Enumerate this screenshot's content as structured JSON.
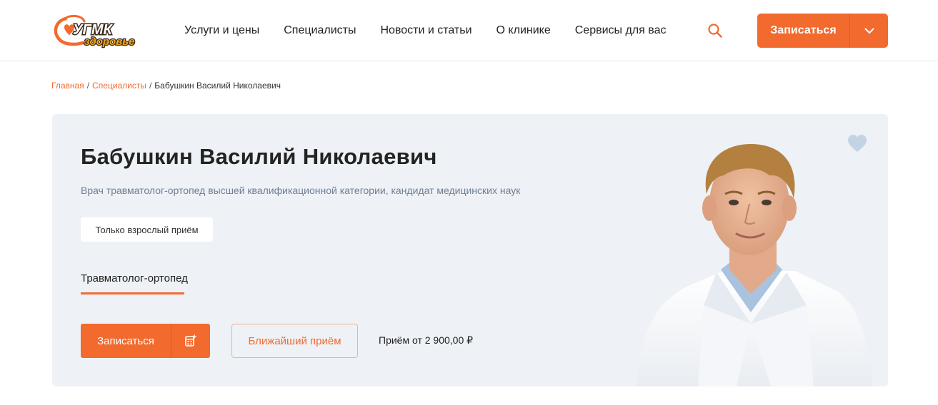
{
  "header": {
    "logo": {
      "top_text": "УГМК",
      "bottom_text": "здоровье"
    },
    "nav": [
      "Услуги и цены",
      "Специалисты",
      "Новости и статьи",
      "О клинике",
      "Сервисы для вас"
    ],
    "search_icon": "search-icon",
    "book_label": "Записаться",
    "dropdown_icon": "chevron-down-icon"
  },
  "breadcrumb": {
    "home": "Главная",
    "section": "Специалисты",
    "separator": "/",
    "current": "Бабушкин Василий Николаевич"
  },
  "doctor": {
    "name": "Бабушкин Василий Николаевич",
    "description": "Врач травматолог-ортопед высшей квалификационной категории, кандидат медицинских наук",
    "badge": "Только взрослый приём",
    "specialty": "Травматолог-ортопед",
    "book_label": "Записаться",
    "calendar_icon": "calendar-plus-icon",
    "nearest_label": "Ближайший приём",
    "price": "Приём от 2 900,00 ₽",
    "favorite_icon": "heart-icon"
  },
  "colors": {
    "accent": "#f26a2e",
    "card_bg": "#eef1f5",
    "desc_text": "#6e7f96",
    "heart": "#c3d3e4"
  }
}
